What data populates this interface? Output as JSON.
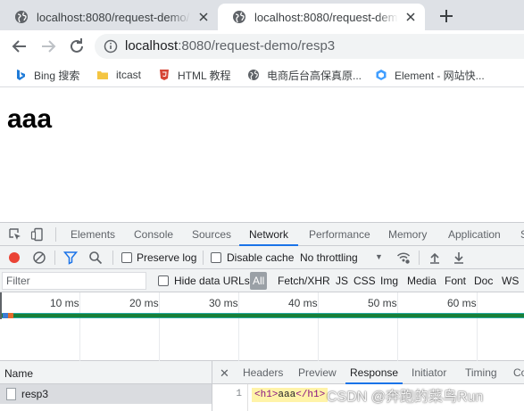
{
  "browser": {
    "tabs": [
      {
        "title": "localhost:8080/request-demo/",
        "active": false
      },
      {
        "title": "localhost:8080/request-demo/",
        "active": true
      }
    ],
    "omnibox": {
      "host": "localhost",
      "rest": ":8080/request-demo/resp3"
    },
    "bookmarks": [
      {
        "label": "Bing 搜索",
        "icon": "bing-icon"
      },
      {
        "label": "itcast",
        "icon": "folder-icon"
      },
      {
        "label": "HTML 教程",
        "icon": "html5-icon"
      },
      {
        "label": "电商后台高保真原...",
        "icon": "globe-icon"
      },
      {
        "label": "Element - 网站快...",
        "icon": "element-icon"
      }
    ]
  },
  "page": {
    "heading": "aaa"
  },
  "devtools": {
    "tabs": [
      "Elements",
      "Console",
      "Sources",
      "Network",
      "Performance",
      "Memory",
      "Application",
      "S"
    ],
    "active_tab": "Network",
    "network_toolbar": {
      "preserve_log": "Preserve log",
      "disable_cache": "Disable cache",
      "throttling": "No throttling"
    },
    "filter": {
      "placeholder": "Filter",
      "hide_data_urls": "Hide data URLs",
      "types": [
        "All",
        "Fetch/XHR",
        "JS",
        "CSS",
        "Img",
        "Media",
        "Font",
        "Doc",
        "WS"
      ]
    },
    "timeline": {
      "ticks": [
        "10 ms",
        "20 ms",
        "30 ms",
        "40 ms",
        "50 ms",
        "60 ms"
      ]
    },
    "requests": {
      "column_name": "Name",
      "rows": [
        {
          "name": "resp3"
        }
      ]
    },
    "detail": {
      "tabs": [
        "Headers",
        "Preview",
        "Response",
        "Initiator",
        "Timing",
        "Co"
      ],
      "active_tab": "Response",
      "line_number": "1",
      "code": {
        "open_tag": "<h1>",
        "text": "aaa",
        "close_tag": "</h1>"
      }
    }
  },
  "watermark": "CSDN @奔跑的菜鸟Run",
  "colors": {
    "accent": "#1a73e8",
    "record": "#ea4335",
    "filter_icon": "#1a73e8"
  }
}
